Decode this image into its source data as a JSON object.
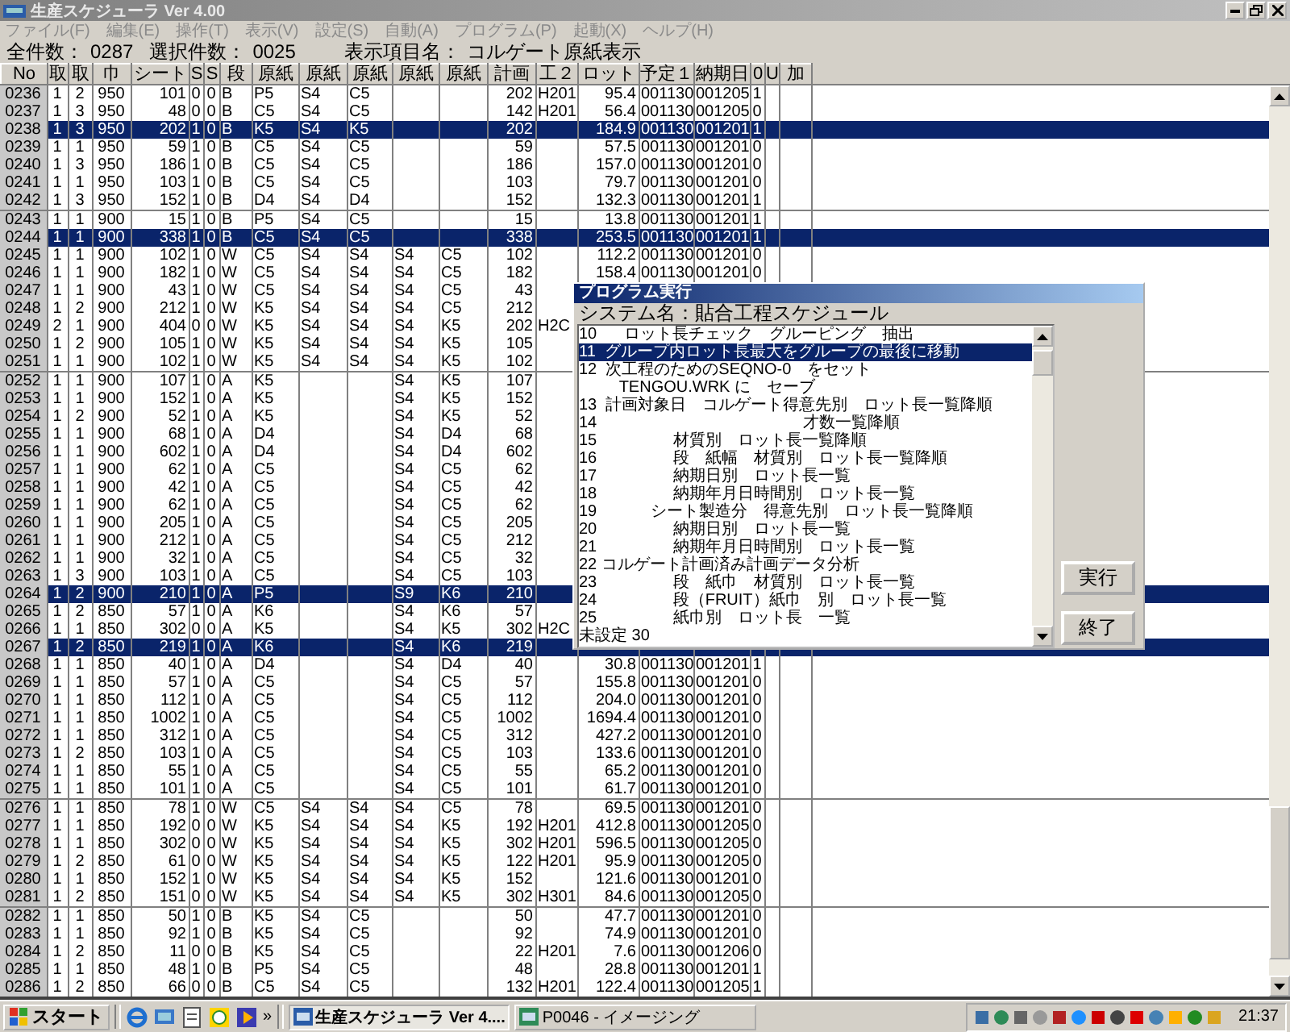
{
  "window": {
    "title": "生産スケジューラ Ver 4.00"
  },
  "menu": [
    {
      "label": "ファイル(F)",
      "disabled": true
    },
    {
      "label": "編集(E)",
      "disabled": true
    },
    {
      "label": "操作(T)",
      "disabled": true
    },
    {
      "label": "表示(V)",
      "disabled": true
    },
    {
      "label": "設定(S)",
      "disabled": true
    },
    {
      "label": "自動(A)",
      "disabled": true
    },
    {
      "label": "プログラム(P)",
      "disabled": true
    },
    {
      "label": "起動(X)",
      "disabled": true
    },
    {
      "label": "ヘルプ(H)",
      "disabled": true
    }
  ],
  "summary": [
    {
      "label": "全件数：",
      "value": "0287"
    },
    {
      "label": "選択件数：",
      "value": "0025"
    },
    {
      "label": "表示項目名：",
      "value": "コルゲート原紙表示"
    }
  ],
  "table": {
    "columns": [
      "No",
      "取",
      "取",
      "巾",
      "シート",
      "S",
      "S",
      "段",
      "原紙",
      "原紙",
      "原紙",
      "原紙",
      "原紙",
      "計画",
      "工２",
      "ロット",
      "予定１",
      "納期日",
      "0",
      "U",
      "加"
    ],
    "groups": [
      {
        "rows": [
          {
            "selected": false,
            "cells": [
              "0236",
              "1",
              "2",
              "950",
              "101",
              "0",
              "0",
              "B",
              "P5",
              "S4",
              "C5",
              "",
              "",
              "202",
              "H201",
              "95.4",
              "001130",
              "001205",
              "1"
            ]
          },
          {
            "selected": false,
            "cells": [
              "0237",
              "1",
              "3",
              "950",
              "48",
              "0",
              "0",
              "B",
              "C5",
              "S4",
              "C5",
              "",
              "",
              "142",
              "H201",
              "56.4",
              "001130",
              "001205",
              "0"
            ]
          },
          {
            "selected": true,
            "cells": [
              "0238",
              "1",
              "3",
              "950",
              "202",
              "1",
              "0",
              "B",
              "K5",
              "S4",
              "K5",
              "",
              "",
              "202",
              "",
              "184.9",
              "001130",
              "001201",
              "1"
            ]
          },
          {
            "selected": false,
            "cells": [
              "0239",
              "1",
              "1",
              "950",
              "59",
              "1",
              "0",
              "B",
              "C5",
              "S4",
              "C5",
              "",
              "",
              "59",
              "",
              "57.5",
              "001130",
              "001201",
              "0"
            ]
          },
          {
            "selected": false,
            "cells": [
              "0240",
              "1",
              "3",
              "950",
              "186",
              "1",
              "0",
              "B",
              "C5",
              "S4",
              "C5",
              "",
              "",
              "186",
              "",
              "157.0",
              "001130",
              "001201",
              "0"
            ]
          },
          {
            "selected": false,
            "cells": [
              "0241",
              "1",
              "1",
              "950",
              "103",
              "1",
              "0",
              "B",
              "C5",
              "S4",
              "C5",
              "",
              "",
              "103",
              "",
              "79.7",
              "001130",
              "001201",
              "0"
            ]
          },
          {
            "selected": false,
            "cells": [
              "0242",
              "1",
              "3",
              "950",
              "152",
              "1",
              "0",
              "B",
              "D4",
              "S4",
              "D4",
              "",
              "",
              "152",
              "",
              "132.3",
              "001130",
              "001201",
              "1"
            ]
          }
        ]
      },
      {
        "rows": [
          {
            "selected": false,
            "cells": [
              "0243",
              "1",
              "1",
              "900",
              "15",
              "1",
              "0",
              "B",
              "P5",
              "S4",
              "C5",
              "",
              "",
              "15",
              "",
              "13.8",
              "001130",
              "001201",
              "1"
            ]
          },
          {
            "selected": true,
            "cells": [
              "0244",
              "1",
              "1",
              "900",
              "338",
              "1",
              "0",
              "B",
              "C5",
              "S4",
              "C5",
              "",
              "",
              "338",
              "",
              "253.5",
              "001130",
              "001201",
              "1"
            ]
          },
          {
            "selected": false,
            "cells": [
              "0245",
              "1",
              "1",
              "900",
              "102",
              "1",
              "0",
              "W",
              "C5",
              "S4",
              "S4",
              "S4",
              "C5",
              "102",
              "",
              "112.2",
              "001130",
              "001201",
              "0"
            ]
          },
          {
            "selected": false,
            "cells": [
              "0246",
              "1",
              "1",
              "900",
              "182",
              "1",
              "0",
              "W",
              "C5",
              "S4",
              "S4",
              "S4",
              "C5",
              "182",
              "",
              "158.4",
              "001130",
              "001201",
              "0"
            ]
          },
          {
            "selected": false,
            "cells": [
              "0247",
              "1",
              "1",
              "900",
              "43",
              "1",
              "0",
              "W",
              "C5",
              "S4",
              "S4",
              "S4",
              "C5",
              "43"
            ]
          },
          {
            "selected": false,
            "cells": [
              "0248",
              "1",
              "2",
              "900",
              "212",
              "1",
              "0",
              "W",
              "K5",
              "S4",
              "S4",
              "S4",
              "C5",
              "212"
            ]
          },
          {
            "selected": false,
            "cells": [
              "0249",
              "2",
              "1",
              "900",
              "404",
              "0",
              "0",
              "W",
              "K5",
              "S4",
              "S4",
              "S4",
              "K5",
              "202",
              "H2C"
            ]
          },
          {
            "selected": false,
            "cells": [
              "0250",
              "1",
              "2",
              "900",
              "105",
              "1",
              "0",
              "W",
              "K5",
              "S4",
              "S4",
              "S4",
              "K5",
              "105"
            ]
          },
          {
            "selected": false,
            "cells": [
              "0251",
              "1",
              "1",
              "900",
              "102",
              "1",
              "0",
              "W",
              "K5",
              "S4",
              "S4",
              "S4",
              "K5",
              "102"
            ]
          }
        ]
      },
      {
        "rows": [
          {
            "selected": false,
            "cells": [
              "0252",
              "1",
              "1",
              "900",
              "107",
              "1",
              "0",
              "A",
              "K5",
              "",
              "",
              "S4",
              "K5",
              "107"
            ]
          },
          {
            "selected": false,
            "cells": [
              "0253",
              "1",
              "1",
              "900",
              "152",
              "1",
              "0",
              "A",
              "K5",
              "",
              "",
              "S4",
              "K5",
              "152"
            ]
          },
          {
            "selected": false,
            "cells": [
              "0254",
              "1",
              "2",
              "900",
              "52",
              "1",
              "0",
              "A",
              "K5",
              "",
              "",
              "S4",
              "K5",
              "52"
            ]
          },
          {
            "selected": false,
            "cells": [
              "0255",
              "1",
              "1",
              "900",
              "68",
              "1",
              "0",
              "A",
              "D4",
              "",
              "",
              "S4",
              "D4",
              "68"
            ]
          },
          {
            "selected": false,
            "cells": [
              "0256",
              "1",
              "1",
              "900",
              "602",
              "1",
              "0",
              "A",
              "D4",
              "",
              "",
              "S4",
              "D4",
              "602"
            ]
          },
          {
            "selected": false,
            "cells": [
              "0257",
              "1",
              "1",
              "900",
              "62",
              "1",
              "0",
              "A",
              "C5",
              "",
              "",
              "S4",
              "C5",
              "62"
            ]
          },
          {
            "selected": false,
            "cells": [
              "0258",
              "1",
              "1",
              "900",
              "42",
              "1",
              "0",
              "A",
              "C5",
              "",
              "",
              "S4",
              "C5",
              "42"
            ]
          },
          {
            "selected": false,
            "cells": [
              "0259",
              "1",
              "1",
              "900",
              "62",
              "1",
              "0",
              "A",
              "C5",
              "",
              "",
              "S4",
              "C5",
              "62"
            ]
          },
          {
            "selected": false,
            "cells": [
              "0260",
              "1",
              "1",
              "900",
              "205",
              "1",
              "0",
              "A",
              "C5",
              "",
              "",
              "S4",
              "C5",
              "205"
            ]
          },
          {
            "selected": false,
            "cells": [
              "0261",
              "1",
              "1",
              "900",
              "212",
              "1",
              "0",
              "A",
              "C5",
              "",
              "",
              "S4",
              "C5",
              "212"
            ]
          },
          {
            "selected": false,
            "cells": [
              "0262",
              "1",
              "1",
              "900",
              "32",
              "1",
              "0",
              "A",
              "C5",
              "",
              "",
              "S4",
              "C5",
              "32"
            ]
          },
          {
            "selected": false,
            "cells": [
              "0263",
              "1",
              "3",
              "900",
              "103",
              "1",
              "0",
              "A",
              "C5",
              "",
              "",
              "S4",
              "C5",
              "103"
            ]
          },
          {
            "selected": true,
            "cells": [
              "0264",
              "1",
              "2",
              "900",
              "210",
              "1",
              "0",
              "A",
              "P5",
              "",
              "",
              "S9",
              "K6",
              "210"
            ]
          },
          {
            "selected": false,
            "cells": [
              "0265",
              "1",
              "2",
              "850",
              "57",
              "1",
              "0",
              "A",
              "K6",
              "",
              "",
              "S4",
              "K6",
              "57"
            ]
          },
          {
            "selected": false,
            "cells": [
              "0266",
              "1",
              "1",
              "850",
              "302",
              "0",
              "0",
              "A",
              "K5",
              "",
              "",
              "S4",
              "K5",
              "302",
              "H2C"
            ]
          },
          {
            "selected": true,
            "cells": [
              "0267",
              "1",
              "2",
              "850",
              "219",
              "1",
              "0",
              "A",
              "K6",
              "",
              "",
              "S4",
              "K6",
              "219"
            ]
          },
          {
            "selected": false,
            "cells": [
              "0268",
              "1",
              "1",
              "850",
              "40",
              "1",
              "0",
              "A",
              "D4",
              "",
              "",
              "S4",
              "D4",
              "40",
              "",
              "30.8",
              "001130",
              "001201",
              "1"
            ]
          },
          {
            "selected": false,
            "cells": [
              "0269",
              "1",
              "1",
              "850",
              "57",
              "1",
              "0",
              "A",
              "C5",
              "",
              "",
              "S4",
              "C5",
              "57",
              "",
              "155.8",
              "001130",
              "001201",
              "0"
            ]
          },
          {
            "selected": false,
            "cells": [
              "0270",
              "1",
              "1",
              "850",
              "112",
              "1",
              "0",
              "A",
              "C5",
              "",
              "",
              "S4",
              "C5",
              "112",
              "",
              "204.0",
              "001130",
              "001201",
              "0"
            ]
          },
          {
            "selected": false,
            "cells": [
              "0271",
              "1",
              "1",
              "850",
              "1002",
              "1",
              "0",
              "A",
              "C5",
              "",
              "",
              "S4",
              "C5",
              "1002",
              "",
              "1694.4",
              "001130",
              "001201",
              "0"
            ]
          },
          {
            "selected": false,
            "cells": [
              "0272",
              "1",
              "1",
              "850",
              "312",
              "1",
              "0",
              "A",
              "C5",
              "",
              "",
              "S4",
              "C5",
              "312",
              "",
              "427.2",
              "001130",
              "001201",
              "0"
            ]
          },
          {
            "selected": false,
            "cells": [
              "0273",
              "1",
              "2",
              "850",
              "103",
              "1",
              "0",
              "A",
              "C5",
              "",
              "",
              "S4",
              "C5",
              "103",
              "",
              "133.6",
              "001130",
              "001201",
              "0"
            ]
          },
          {
            "selected": false,
            "cells": [
              "0274",
              "1",
              "1",
              "850",
              "55",
              "1",
              "0",
              "A",
              "C5",
              "",
              "",
              "S4",
              "C5",
              "55",
              "",
              "65.2",
              "001130",
              "001201",
              "0"
            ]
          },
          {
            "selected": false,
            "cells": [
              "0275",
              "1",
              "1",
              "850",
              "101",
              "1",
              "0",
              "A",
              "C5",
              "",
              "",
              "S4",
              "C5",
              "101",
              "",
              "61.7",
              "001130",
              "001201",
              "0"
            ]
          }
        ]
      },
      {
        "rows": [
          {
            "selected": false,
            "cells": [
              "0276",
              "1",
              "1",
              "850",
              "78",
              "1",
              "0",
              "W",
              "C5",
              "S4",
              "S4",
              "S4",
              "C5",
              "78",
              "",
              "69.5",
              "001130",
              "001201",
              "0"
            ]
          },
          {
            "selected": false,
            "cells": [
              "0277",
              "1",
              "1",
              "850",
              "192",
              "0",
              "0",
              "W",
              "K5",
              "S4",
              "S4",
              "S4",
              "K5",
              "192",
              "H201",
              "412.8",
              "001130",
              "001205",
              "0"
            ]
          },
          {
            "selected": false,
            "cells": [
              "0278",
              "1",
              "1",
              "850",
              "302",
              "0",
              "0",
              "W",
              "K5",
              "S4",
              "S4",
              "S4",
              "K5",
              "302",
              "H201",
              "596.5",
              "001130",
              "001205",
              "0"
            ]
          },
          {
            "selected": false,
            "cells": [
              "0279",
              "1",
              "2",
              "850",
              "61",
              "0",
              "0",
              "W",
              "K5",
              "S4",
              "S4",
              "S4",
              "K5",
              "122",
              "H201",
              "95.9",
              "001130",
              "001205",
              "0"
            ]
          },
          {
            "selected": false,
            "cells": [
              "0280",
              "1",
              "1",
              "850",
              "152",
              "1",
              "0",
              "W",
              "K5",
              "S4",
              "S4",
              "S4",
              "K5",
              "152",
              "",
              "121.6",
              "001130",
              "001201",
              "0"
            ]
          },
          {
            "selected": false,
            "cells": [
              "0281",
              "1",
              "2",
              "850",
              "151",
              "0",
              "0",
              "W",
              "K5",
              "S4",
              "S4",
              "S4",
              "K5",
              "302",
              "H301",
              "84.6",
              "001130",
              "001205",
              "0"
            ]
          }
        ]
      },
      {
        "rows": [
          {
            "selected": false,
            "cells": [
              "0282",
              "1",
              "1",
              "850",
              "50",
              "1",
              "0",
              "B",
              "K5",
              "S4",
              "C5",
              "",
              "",
              "50",
              "",
              "47.7",
              "001130",
              "001201",
              "0"
            ]
          },
          {
            "selected": false,
            "cells": [
              "0283",
              "1",
              "1",
              "850",
              "92",
              "1",
              "0",
              "B",
              "K5",
              "S4",
              "C5",
              "",
              "",
              "92",
              "",
              "74.9",
              "001130",
              "001201",
              "0"
            ]
          },
          {
            "selected": false,
            "cells": [
              "0284",
              "1",
              "2",
              "850",
              "11",
              "0",
              "0",
              "B",
              "K5",
              "S4",
              "C5",
              "",
              "",
              "22",
              "H201",
              "7.6",
              "001130",
              "001206",
              "0"
            ]
          },
          {
            "selected": false,
            "cells": [
              "0285",
              "1",
              "1",
              "850",
              "48",
              "1",
              "0",
              "B",
              "P5",
              "S4",
              "C5",
              "",
              "",
              "48",
              "",
              "28.8",
              "001130",
              "001201",
              "1"
            ]
          },
          {
            "selected": false,
            "cells": [
              "0286",
              "1",
              "2",
              "850",
              "66",
              "0",
              "0",
              "B",
              "C5",
              "S4",
              "C5",
              "",
              "",
              "132",
              "H201",
              "122.4",
              "001130",
              "001205",
              "1"
            ]
          }
        ]
      }
    ]
  },
  "dialog": {
    "title": "プログラム実行",
    "system_label": "システム名：",
    "system_name": "貼合工程スケジュール",
    "items": [
      {
        "text": "10      ロット長チェック　グルーピング　抽出",
        "selected": false
      },
      {
        "text": "11  グループ内ロット長最大をグループの最後に移動",
        "selected": true
      },
      {
        "text": "12  次工程のためのSEQNO-0　をセット",
        "selected": false
      },
      {
        "text": "         TENGOU.WRK に　セーブ",
        "selected": false
      },
      {
        "text": "13  計画対象日　コルゲート得意先別　ロット長一覧降順",
        "selected": false
      },
      {
        "text": "14                                              才数一覧降順",
        "selected": false
      },
      {
        "text": "15                 材質別　ロット長一覧降順",
        "selected": false
      },
      {
        "text": "16                 段　紙幅　材質別　ロット長一覧降順",
        "selected": false
      },
      {
        "text": "17                 納期日別　ロット長一覧",
        "selected": false
      },
      {
        "text": "18                 納期年月日時間別　ロット長一覧",
        "selected": false
      },
      {
        "text": "19            シート製造分　得意先別　ロット長一覧降順",
        "selected": false
      },
      {
        "text": "20                 納期日別　ロット長一覧",
        "selected": false
      },
      {
        "text": "21                 納期年月日時間別　ロット長一覧",
        "selected": false
      },
      {
        "text": "22 コルゲート計画済み計画データ分析",
        "selected": false
      },
      {
        "text": "23                 段　紙巾　材質別　ロット長一覧",
        "selected": false
      },
      {
        "text": "24                 段（FRUIT）紙巾　別　ロット長一覧",
        "selected": false
      },
      {
        "text": "25                 紙巾別　ロット長　一覧",
        "selected": false
      },
      {
        "text": "未設定 30",
        "selected": false
      }
    ],
    "buttons": [
      "実行",
      "終了"
    ]
  },
  "taskbar": {
    "start": "スタート",
    "overflow": "»",
    "tasks": [
      {
        "label": "生産スケジューラ Ver 4....",
        "selected": true
      },
      {
        "label": "P0046 - イメージング",
        "selected": false
      }
    ],
    "clock": "21:37"
  }
}
